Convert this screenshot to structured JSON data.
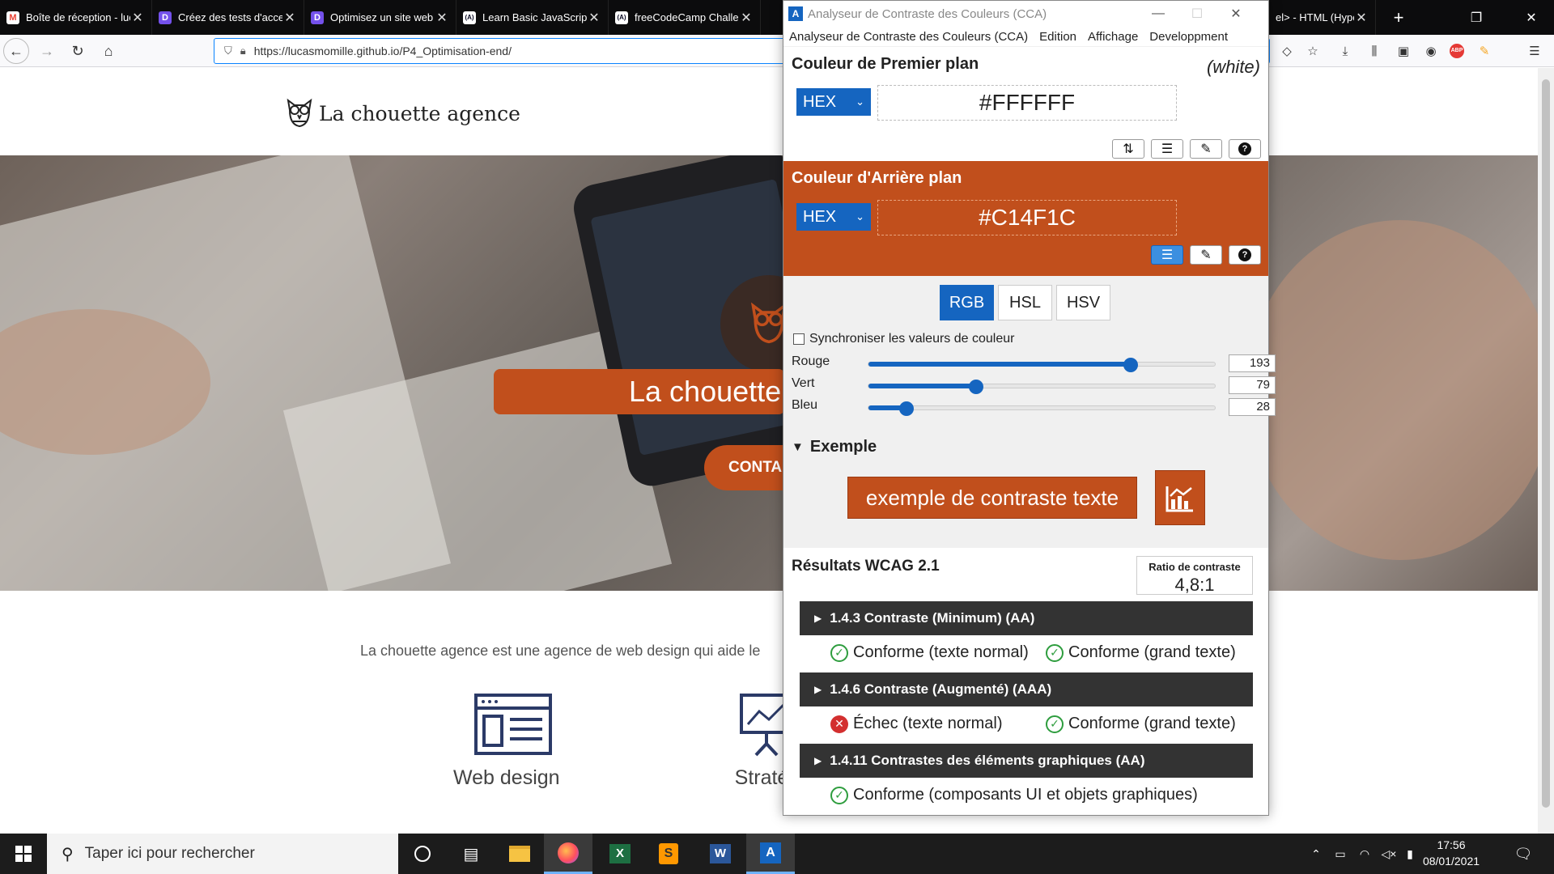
{
  "browser": {
    "tabs": [
      {
        "label": "Boîte de réception - luc",
        "favicon": "gmail-icon",
        "color": "#ea4335",
        "glyph": "M"
      },
      {
        "label": "Créez des tests d'acces",
        "favicon": "openclassrooms-icon",
        "color": "#7451eb",
        "glyph": "D"
      },
      {
        "label": "Optimisez un site web",
        "favicon": "openclassrooms-icon",
        "color": "#7451eb",
        "glyph": "D"
      },
      {
        "label": "Learn Basic JavaScript:",
        "favicon": "freecodecamp-icon",
        "color": "#0a0a23",
        "glyph": "(A)"
      },
      {
        "label": "freeCodeCamp Challen",
        "favicon": "freecodecamp-icon",
        "color": "#0a0a23",
        "glyph": "(A)"
      }
    ],
    "right_tab": {
      "label": "el> - HTML (Hype",
      "favicon": "mdn-icon"
    },
    "url": "https://lucasmomille.github.io/P4_Optimisation-end/"
  },
  "site": {
    "logo_text": "La chouette agence",
    "hero_title": "La chouette",
    "hero_button": "CONTA",
    "intro": "La chouette agence est une agence de web design qui aide le",
    "services": [
      {
        "label": "Web design",
        "icon": "web-design-icon"
      },
      {
        "label": "Straté",
        "icon": "strategy-icon"
      }
    ]
  },
  "cca": {
    "window_title": "Analyseur de Contraste des Couleurs (CCA)",
    "menu": [
      "Analyseur de Contraste des Couleurs (CCA)",
      "Edition",
      "Affichage",
      "Developpment"
    ],
    "foreground": {
      "title": "Couleur de Premier plan",
      "name": "(white)",
      "format": "HEX",
      "value": "#FFFFFF"
    },
    "background": {
      "title": "Couleur d'Arrière plan",
      "format": "HEX",
      "value": "#C14F1C",
      "color": "#c14f1c"
    },
    "models": [
      "RGB",
      "HSL",
      "HSV"
    ],
    "active_model": "RGB",
    "sync_label": "Synchroniser les valeurs de couleur",
    "sliders": [
      {
        "label": "Rouge",
        "value": 193,
        "max": 255
      },
      {
        "label": "Vert",
        "value": 79,
        "max": 255
      },
      {
        "label": "Bleu",
        "value": 28,
        "max": 255
      }
    ],
    "example": {
      "heading": "Exemple",
      "text": "exemple de contraste texte"
    },
    "results": {
      "title": "Résultats WCAG 2.1",
      "ratio_label": "Ratio de contraste",
      "ratio_value": "4,8:1",
      "criteria": [
        {
          "title": "1.4.3 Contraste (Minimum) (AA)",
          "lines": [
            {
              "status": "pass",
              "text": "Conforme (texte normal)"
            },
            {
              "status": "pass",
              "text": "Conforme (grand texte)"
            }
          ]
        },
        {
          "title": "1.4.6 Contraste (Augmenté) (AAA)",
          "lines": [
            {
              "status": "fail",
              "text": "Échec (texte normal)"
            },
            {
              "status": "pass",
              "text": "Conforme (grand texte)"
            }
          ]
        },
        {
          "title": "1.4.11 Contrastes des éléments graphiques (AA)",
          "lines": [
            {
              "status": "pass",
              "text": "Conforme (composants UI et objets graphiques)"
            }
          ]
        }
      ]
    }
  },
  "taskbar": {
    "search_placeholder": "Taper ici pour rechercher",
    "time": "17:56",
    "date": "08/01/2021"
  },
  "colors": {
    "accent": "#1565c0",
    "brand_orange": "#c14f1c",
    "pass": "#2e9d3e",
    "fail": "#d32f2f"
  }
}
